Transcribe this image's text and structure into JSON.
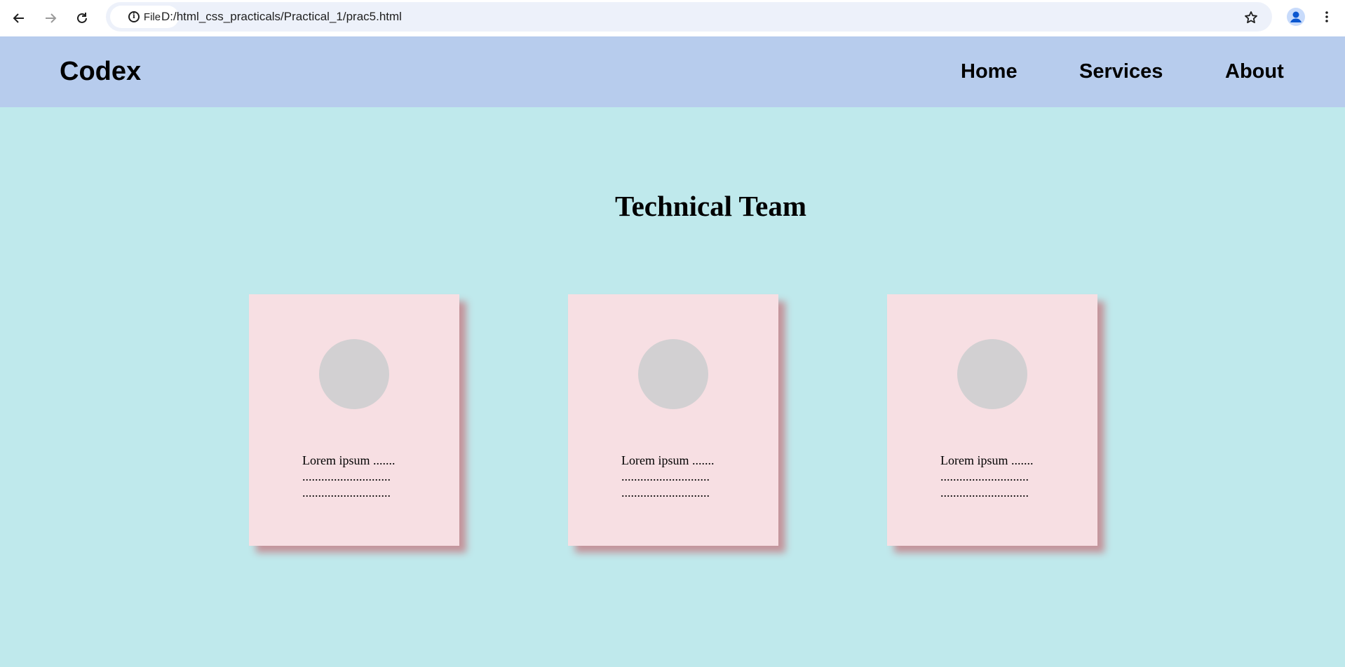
{
  "browser": {
    "site_chip_label": "File",
    "url": "D:/html_css_practicals/Practical_1/prac5.html"
  },
  "header": {
    "logo": "Codex",
    "nav": [
      "Home",
      "Services",
      "About"
    ]
  },
  "main": {
    "title": "Technical Team",
    "cards": [
      {
        "lines": [
          "Lorem ipsum .......",
          "............................",
          "............................"
        ]
      },
      {
        "lines": [
          "Lorem ipsum .......",
          "............................",
          "............................"
        ]
      },
      {
        "lines": [
          "Lorem ipsum .......",
          "............................",
          "............................"
        ]
      }
    ]
  },
  "colors": {
    "page_background": "#bfe9ec",
    "header_background": "#b7cced",
    "card_background": "#f7dfe3",
    "card_shadow": "#c4939a",
    "avatar": "#d2d0d2"
  }
}
